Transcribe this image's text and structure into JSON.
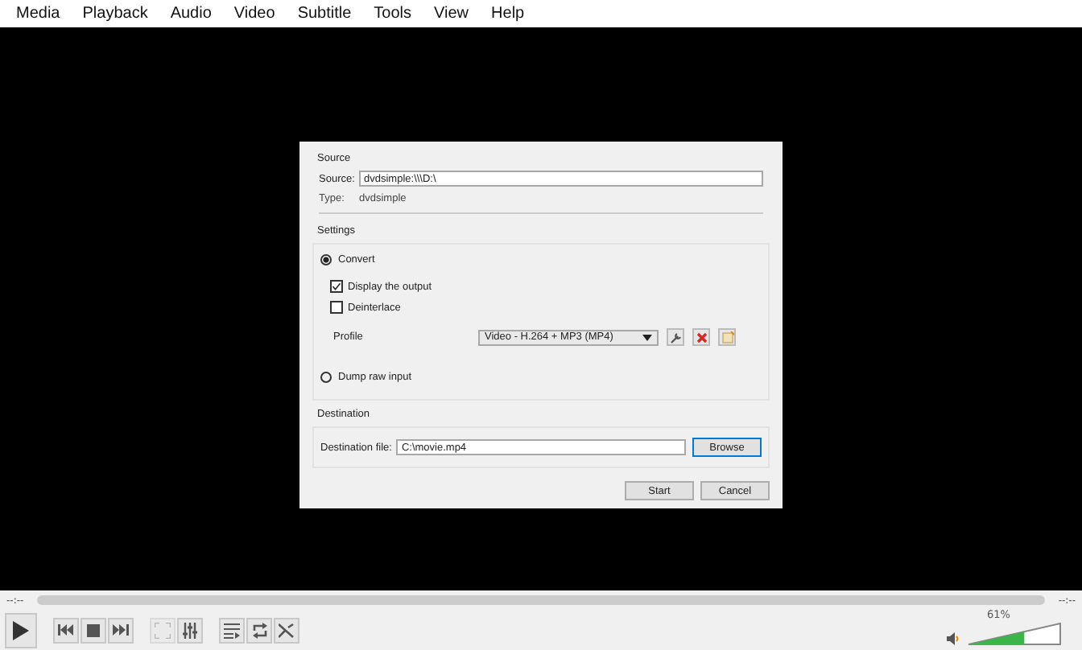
{
  "menu": [
    "Media",
    "Playback",
    "Audio",
    "Video",
    "Subtitle",
    "Tools",
    "View",
    "Help"
  ],
  "dialog": {
    "source": {
      "title": "Source",
      "source_label": "Source:",
      "source_value": "dvdsimple:\\\\\\D:\\",
      "type_label": "Type:",
      "type_value": "dvdsimple"
    },
    "settings": {
      "title": "Settings",
      "options": [
        {
          "label": "Convert",
          "selected": true
        },
        {
          "label": "Dump raw input",
          "selected": false
        }
      ],
      "checks": [
        {
          "label": "Display the output",
          "checked": true
        },
        {
          "label": "Deinterlace",
          "checked": false
        }
      ],
      "profile_label": "Profile",
      "profile_value": "Video - H.264 + MP3 (MP4)"
    },
    "destination": {
      "title": "Destination",
      "file_label": "Destination file:",
      "file_value": "C:\\movie.mp4",
      "browse": "Browse"
    },
    "buttons": [
      "Start",
      "Cancel"
    ]
  },
  "player": {
    "time_elapsed": "--:--",
    "time_total": "--:--",
    "fullscreen_disabled": true,
    "volume": {
      "level": 0.61,
      "reading": "61%"
    }
  }
}
